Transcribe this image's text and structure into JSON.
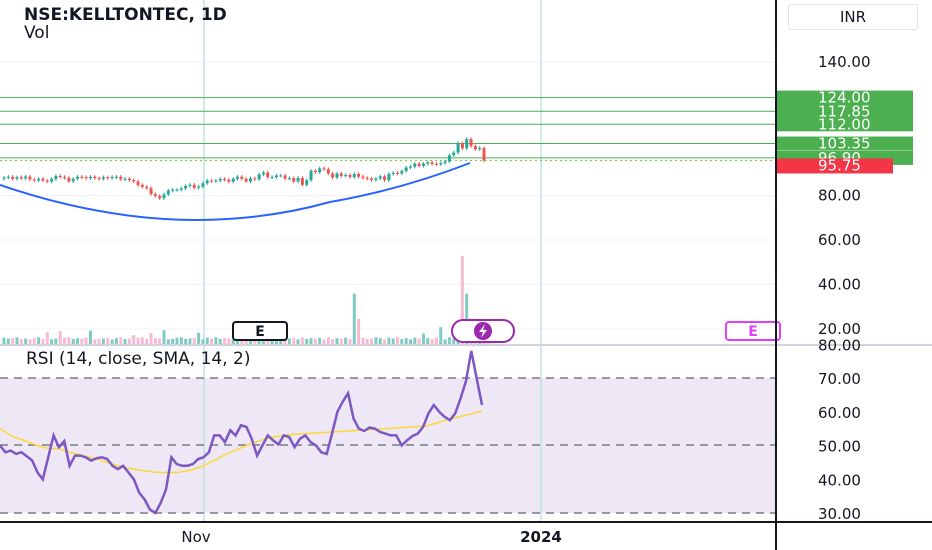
{
  "header": {
    "title": "NSE:KELLTONTEC, 1D",
    "volume_label": "Vol"
  },
  "currency": "INR",
  "rsi": {
    "label": "RSI (14, close, SMA, 14, 2)",
    "color": "#7e57c2",
    "sma_color": "#fdd835",
    "band_fill": "#ede7f6"
  },
  "colors": {
    "up": "#26a69a",
    "down": "#ef5350",
    "curve": "#2962ff",
    "level_line": "#4caf50",
    "current_price": "#f23645",
    "level_tag": "#4caf50",
    "earnings_mark": "#131722",
    "dividend_mark": "#e040fb",
    "divider": "#131722"
  },
  "markers": {
    "earnings_1": "E",
    "earnings_2": "E",
    "event_icon": "lightning-icon"
  },
  "chart_data": [
    {
      "type": "candlestick",
      "title": "NSE:KELLTONTEC, 1D",
      "y_axis": {
        "ticks": [
          "140.00",
          "80.00",
          "60.00",
          "40.00",
          "20.00"
        ],
        "tick_values": [
          140,
          80,
          60,
          40,
          20
        ],
        "range": [
          13,
          145
        ]
      },
      "x_axis": {
        "labels": [
          "Nov",
          "2024"
        ]
      },
      "levels": [
        {
          "value": 124.0,
          "label": "124.00"
        },
        {
          "value": 117.85,
          "label": "117.85"
        },
        {
          "value": 112.0,
          "label": "112.00"
        },
        {
          "value": 103.35,
          "label": "103.35"
        },
        {
          "value": 96.9,
          "label": "96.90"
        }
      ],
      "current_price": {
        "value": 95.75,
        "label": "95.75"
      },
      "closes": [
        88,
        88.4,
        87.5,
        88.2,
        87.7,
        88.5,
        87.2,
        86.8,
        87.5,
        86.7,
        86.3,
        87.4,
        88.8,
        88.3,
        87.9,
        86.4,
        87.5,
        88.4,
        88.2,
        87.8,
        88.4,
        87.8,
        87.5,
        88.2,
        87.9,
        88.3,
        88.4,
        87.3,
        87.5,
        86.9,
        86.3,
        84.7,
        83.9,
        83.3,
        80.6,
        79.8,
        78.8,
        80.5,
        82.2,
        82.6,
        82.6,
        83.2,
        84.3,
        84.8,
        83.5,
        84,
        85.5,
        86.7,
        86.5,
        86.7,
        87.4,
        87.1,
        86.2,
        87.5,
        88.4,
        87.5,
        86.3,
        87.7,
        87.3,
        89.5,
        90.3,
        88.2,
        88.3,
        89,
        89,
        87.6,
        87.8,
        86.3,
        87.9,
        84.8,
        86.9,
        91.1,
        90.5,
        92.2,
        91.8,
        89.9,
        88.1,
        89.9,
        88.8,
        89.2,
        88.3,
        89.7,
        88.5,
        87.9,
        87.6,
        87,
        87.6,
        88.6,
        86.9,
        89.7,
        90.2,
        89.9,
        91,
        92.6,
        93,
        94.3,
        93.3,
        94.3,
        94.9,
        94.2,
        94,
        94.6,
        95.3,
        98.1,
        99.3,
        103.5,
        101.2,
        105.4,
        102.2,
        100.8,
        101.3,
        95.75
      ],
      "volume": [
        1.5,
        1.3,
        1.4,
        1.6,
        1.2,
        1.3,
        1.1,
        1.4,
        1.6,
        1.2,
        2.8,
        1.1,
        1.3,
        3.1,
        1.5,
        1.6,
        1.2,
        1.4,
        1.3,
        1.5,
        3.2,
        1.1,
        1.2,
        1.3,
        1.5,
        1.1,
        1.4,
        1.6,
        1.2,
        1.3,
        2.1,
        1.5,
        1.6,
        1.2,
        2.6,
        1.4,
        1.3,
        3.3,
        1.1,
        1.2,
        1.5,
        1.6,
        1.2,
        1.3,
        1.4,
        2.7,
        1.1,
        1.5,
        1.3,
        1.6,
        1.2,
        1.4,
        1.3,
        1.1,
        1.2,
        1.5,
        1.6,
        1.3,
        1.2,
        1.4,
        1.1,
        1.5,
        1.6,
        1.3,
        1.2,
        1.4,
        1.3,
        1.5,
        1.1,
        1.6,
        1.2,
        1.4,
        1.3,
        1.5,
        1.1,
        1.6,
        1.2,
        1.4,
        1.3,
        1.5,
        1.2,
        12,
        6,
        1.5,
        1.2,
        1.3,
        1.6,
        1.4,
        1.1,
        1.5,
        1.3,
        1.6,
        1.2,
        1.4,
        1.1,
        1.5,
        1.3,
        2.5,
        1.4,
        1.2,
        1.5,
        4,
        1.1,
        1.6,
        1.3,
        5,
        21,
        12,
        4.5,
        3.5,
        3,
        2.5,
        2
      ]
    },
    {
      "type": "line",
      "title": "RSI (14, close, SMA, 14, 2)",
      "y_axis": {
        "ticks": [
          "80.00",
          "70.00",
          "60.00",
          "50.00",
          "40.00",
          "30.00"
        ],
        "tick_values": [
          80,
          70,
          60,
          50,
          40,
          30
        ],
        "range": [
          29,
          80.5
        ]
      },
      "bands": {
        "upper": 70,
        "middle": 50,
        "lower": 30
      },
      "series": [
        {
          "role": "rsi",
          "values": [
            50,
            48,
            48.5,
            47.5,
            48,
            46.8,
            45.6,
            42,
            40,
            46.5,
            53,
            49.5,
            51.3,
            44,
            47,
            47,
            46.5,
            45.5,
            46.2,
            46.5,
            46,
            44,
            43,
            44,
            42,
            40,
            36,
            34,
            31,
            30,
            33,
            37,
            46.5,
            44.5,
            44,
            44,
            44.5,
            46,
            46.5,
            48,
            53,
            53,
            51,
            54.5,
            53,
            56,
            55.5,
            52,
            47,
            50,
            53,
            51.5,
            50.3,
            53,
            52.5,
            49.5,
            52,
            53,
            51,
            50,
            48,
            47.5,
            53.5,
            60,
            63,
            65.5,
            58,
            55,
            54.3,
            55.3,
            55,
            54,
            53.5,
            53,
            53,
            50,
            51.5,
            52.8,
            53.5,
            55.5,
            59.5,
            62,
            60,
            58.5,
            57.5,
            59.5,
            64,
            69,
            78,
            70,
            62
          ]
        },
        {
          "role": "sma",
          "values": [
            55,
            54,
            53,
            52.3,
            51.8,
            51.2,
            50.6,
            50,
            49.5,
            49.2,
            49.2,
            49,
            48.5,
            48,
            47.6,
            47.2,
            46.8,
            46.4,
            46,
            45.5,
            45,
            44.5,
            44,
            43.5,
            43.2,
            43,
            42.7,
            42.5,
            42.3,
            42.1,
            42,
            42,
            42,
            42,
            42.2,
            42.5,
            42.9,
            43.4,
            44,
            44.8,
            45.6,
            46.4,
            47.2,
            48,
            48.6,
            49.3,
            50,
            50.6,
            51.2,
            51.7,
            52.1,
            52.5,
            52.8,
            53,
            53.2,
            53.3,
            53.4,
            53.5,
            53.6,
            53.7,
            53.8,
            53.9,
            54,
            54.1,
            54.2,
            54.3,
            54.4,
            54.5,
            54.6,
            54.7,
            54.8,
            54.9,
            55,
            55.1,
            55.2,
            55.3,
            55.4,
            55.5,
            55.6,
            55.7,
            56,
            56.4,
            56.9,
            57.4,
            57.8,
            58.2,
            58.6,
            59,
            59.4,
            59.8,
            60.2
          ]
        }
      ]
    }
  ]
}
